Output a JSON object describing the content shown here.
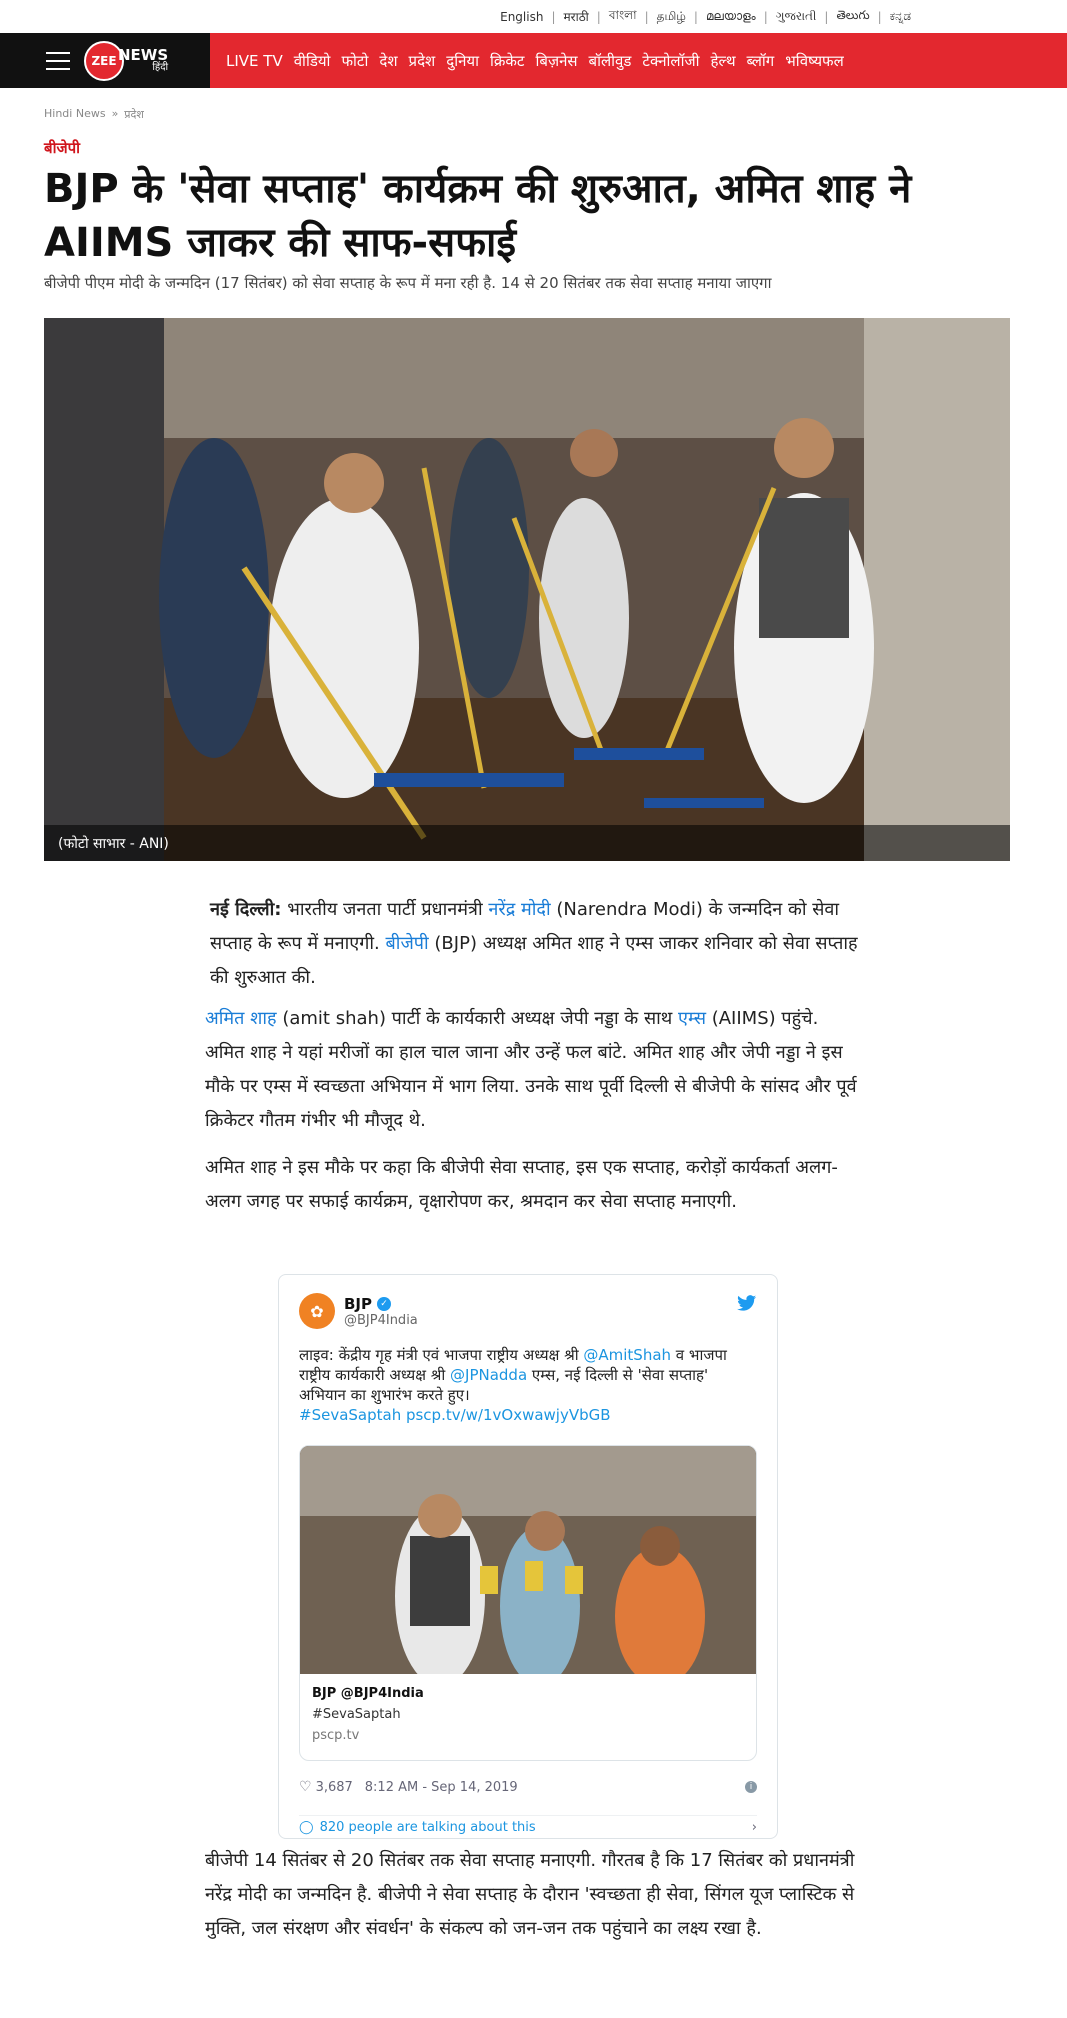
{
  "langbar": [
    "English",
    "मराठी",
    "বাংলা",
    "தமிழ்",
    "മലയാളം",
    "ગુજરાતી",
    "తెలుగు",
    "ಕನ್ನಡ"
  ],
  "brand": {
    "circle": "ZEE",
    "name": "NEWS",
    "sub": "हिंदी"
  },
  "nav": [
    "LIVE TV",
    "वीडियो",
    "फोटो",
    "देश",
    "प्रदेश",
    "दुनिया",
    "क्रिकेट",
    "बिज़नेस",
    "बॉलीवुड",
    "टेक्नोलॉजी",
    "हेल्थ",
    "ब्लॉग",
    "भविष्यफल"
  ],
  "breadcrumb": {
    "home": "Hindi News",
    "sep": "»",
    "section": "प्रदेश"
  },
  "category": "बीजेपी",
  "headline": "BJP के 'सेवा सप्ताह' कार्यक्रम की शुरुआत, अमित शाह ने AIIMS जाकर की साफ-सफाई",
  "subhead": "बीजेपी पीएम मोदी के जन्मदिन (17 सितंबर) को सेवा सप्ताह के रूप में मना रही है.  14 से 20 सितंबर तक सेवा सप्ताह मनाया जाएगा",
  "hero_caption": "(फोटो साभार - ANI)",
  "p1": {
    "dateline": "नई दिल्ली:",
    "t1": " भारतीय जनता पार्टी प्रधानमंत्री ",
    "link1": "नरेंद्र मोदी",
    "t2": " (Narendra Modi) के जन्मदिन को सेवा सप्ताह के रूप में मनाएगी. ",
    "link2": "बीजेपी",
    "t3": " (BJP) अध्यक्ष अमित शाह ने एम्स जाकर शनिवार को सेवा सप्ताह की शुरुआत की."
  },
  "p2": {
    "link1": "अमित शाह",
    "t1": " (amit shah) पार्टी के कार्यकारी अध्यक्ष जेपी नड्डा के साथ ",
    "link2": "एम्स",
    "t2": " (AIIMS) पहुंचे. अमित शाह ने यहां मरीजों का हाल चाल जाना और उन्हें फल बांटे. अमित शाह और जेपी नड्डा ने इस मौके पर एम्स में स्वच्छता अभियान में भाग लिया.  उनके साथ पूर्वी दिल्ली से बीजेपी के सांसद और पूर्व क्रिकेटर गौतम गंभीर भी मौजूद थे."
  },
  "p3": "अमित शाह ने इस मौके पर कहा कि बीजेपी सेवा सप्ताह, इस एक सप्ताह, करोड़ों कार्यकर्ता अलग-अलग जगह पर सफाई कार्यक्रम, वृक्षारोपण कर, श्रमदान कर सेवा सप्ताह मनाएगी.",
  "tweet": {
    "name": "BJP",
    "handle": "@BJP4India",
    "t1": "लाइव: केंद्रीय गृह मंत्री एवं भाजपा राष्ट्रीय अध्यक्ष श्री ",
    "m1": "@AmitShah",
    "t2": " व भाजपा राष्ट्रीय कार्यकारी अध्यक्ष श्री ",
    "m2": "@JPNadda",
    "t3": " एम्स, नई दिल्ली से 'सेवा सप्ताह' अभियान का शुभारंभ करते हुए।",
    "hashtag": "#SevaSaptah",
    "link": " pscp.tv/w/1vOxwawjyVbGB",
    "card_title": "BJP @BJP4India",
    "card_desc": "#SevaSaptah",
    "card_domain": "pscp.tv",
    "likes": "3,687",
    "time": "8:12 AM - Sep 14, 2019",
    "talking": "820 people are talking about this"
  },
  "p4": "बीजेपी 14 सितंबर से 20 सितंबर तक सेवा सप्ताह मनाएगी. गौरतब है कि 17 सितंबर को प्रधानमंत्री नरेंद्र मोदी का जन्मदिन है.  बीजेपी ने सेवा सप्ताह के दौरान  'स्वच्छता ही सेवा, सिंगल यूज प्लास्टिक से मुक्ति, जल संरक्षण और संवर्धन' के संकल्प को जन-जन तक पहुंचाने का लक्ष्य रखा है."
}
